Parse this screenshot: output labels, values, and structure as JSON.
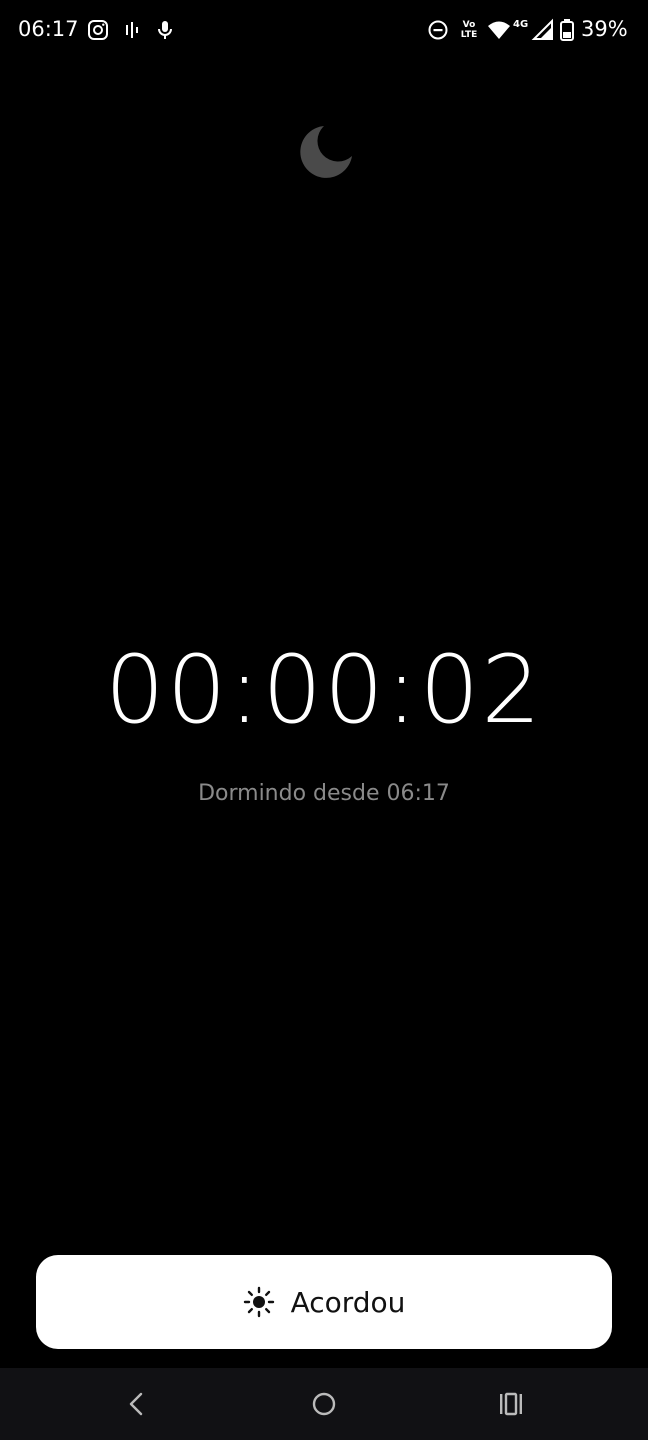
{
  "status_bar": {
    "time": "06:17",
    "volte_top": "Vo",
    "volte_bottom": "LTE",
    "network_type": "4G",
    "battery": "39%",
    "icons": [
      "instagram-icon",
      "audio-wave-icon",
      "mic-notification-icon",
      "do-not-disturb-icon",
      "volte-icon",
      "wifi-icon",
      "cell-signal-icon",
      "battery-icon"
    ]
  },
  "sleep": {
    "icon": "moon-icon",
    "elapsed": "00:00:02",
    "since_label": "Dormindo desde 06:17"
  },
  "wake_button": {
    "icon": "sun-icon",
    "label": "Acordou"
  },
  "nav": {
    "back": "back-icon",
    "home": "home-icon",
    "recents": "recents-icon"
  },
  "colors": {
    "background": "#000000",
    "subtext": "#8a8a8a",
    "button_bg": "#ffffff",
    "button_text": "#111111",
    "moon": "#4a4a4a",
    "nav_bg": "#111114"
  }
}
